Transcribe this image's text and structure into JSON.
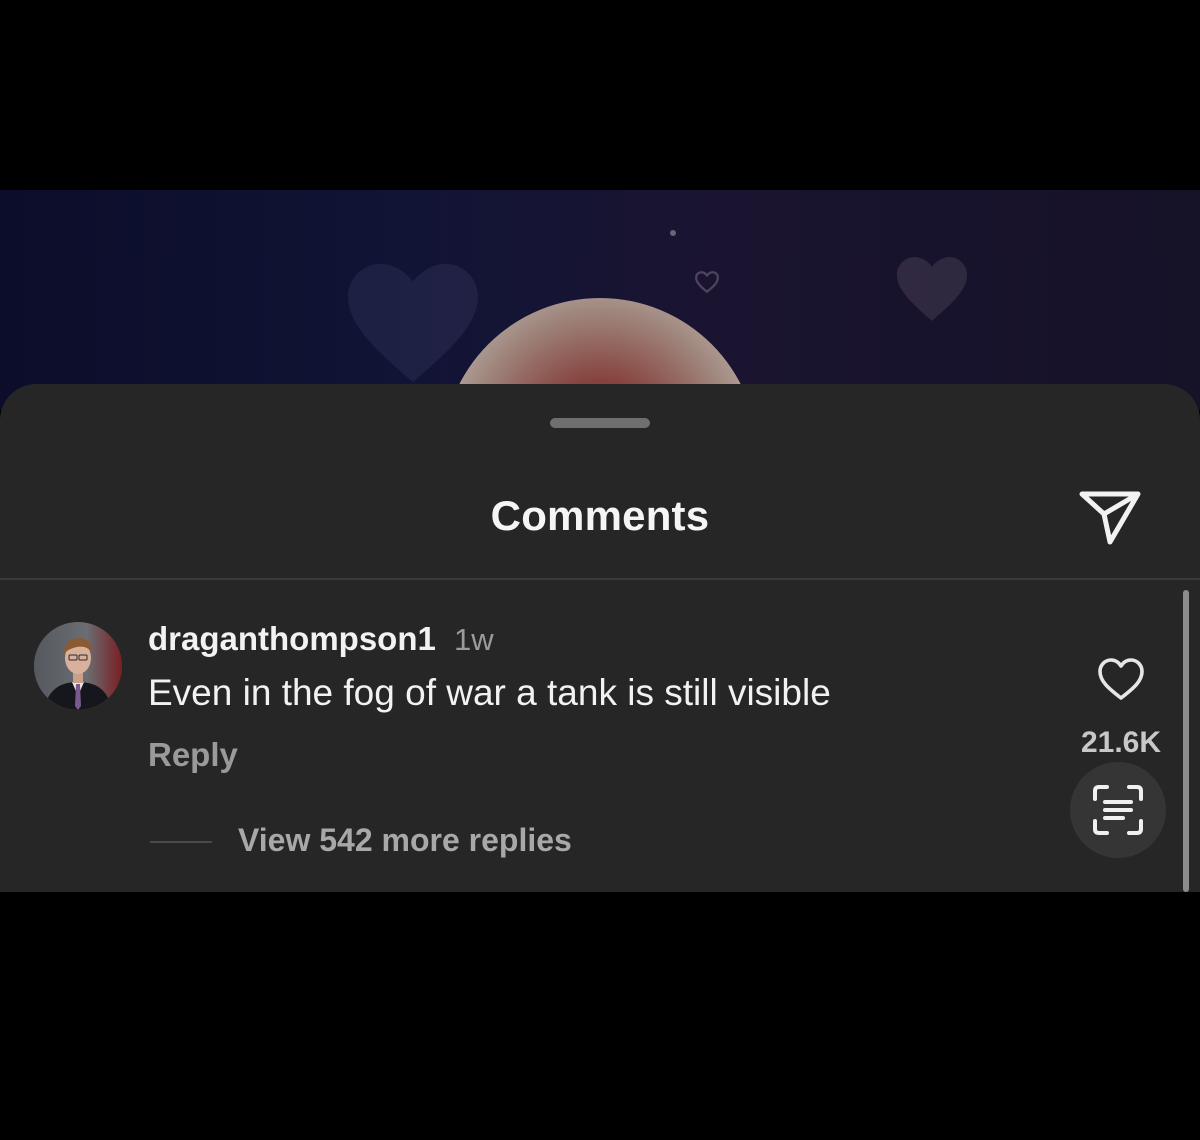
{
  "sheet": {
    "title": "Comments"
  },
  "comment": {
    "username": "draganthompson1",
    "timestamp": "1w",
    "text": "Even in the fog of war a tank is still visible",
    "reply_label": "Reply",
    "like_count": "21.6K",
    "view_replies_label": "View 542 more replies"
  },
  "icons": {
    "send": "send-icon",
    "like": "heart-icon",
    "scan": "text-scan-icon"
  },
  "colors": {
    "sheet_background": "#262626",
    "primary_text": "#f2f2f2",
    "secondary_text": "#9a9a9a"
  }
}
